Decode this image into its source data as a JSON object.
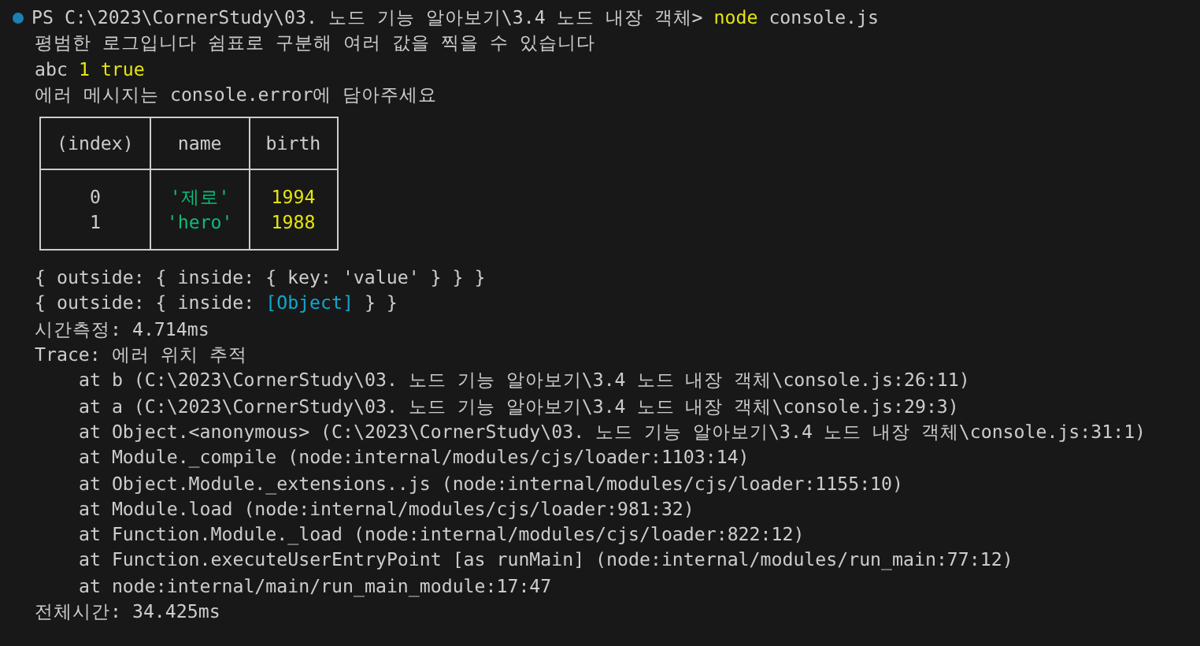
{
  "prompt": {
    "prefix": "PS C:\\2023\\CornerStudy\\03. 노드 기능 알아보기\\3.4 노드 내장 객체>",
    "command": "node",
    "args": "console.js"
  },
  "output_before": [
    {
      "segments": [
        {
          "text": "평범한 로그입니다 쉼표로 구분해 여러 값을 찍을 수 있습니다",
          "kind": "plain"
        }
      ]
    },
    {
      "segments": [
        {
          "text": "abc",
          "kind": "plain"
        },
        {
          "text": "1",
          "kind": "number"
        },
        {
          "text": "true",
          "kind": "number"
        }
      ]
    },
    {
      "segments": [
        {
          "text": "에러 메시지는 console.error에 담아주세요",
          "kind": "plain"
        }
      ]
    }
  ],
  "table": {
    "columns": [
      "(index)",
      "name",
      "birth"
    ],
    "rows": [
      [
        {
          "text": "0",
          "kind": "plain"
        },
        {
          "text": "'제로'",
          "kind": "string"
        },
        {
          "text": "1994",
          "kind": "number"
        }
      ],
      [
        {
          "text": "1",
          "kind": "plain"
        },
        {
          "text": "'hero'",
          "kind": "string"
        },
        {
          "text": "1988",
          "kind": "number"
        }
      ]
    ]
  },
  "output_after": [
    {
      "segments": [
        {
          "text": "{ outside: { inside: { key: 'value' } } }",
          "kind": "plain"
        }
      ]
    },
    {
      "segments": [
        {
          "text": "{ outside: { inside:",
          "kind": "plain"
        },
        {
          "text": "[Object]",
          "kind": "special"
        },
        {
          "text": "} }",
          "kind": "plain"
        }
      ]
    },
    {
      "segments": [
        {
          "text": "시간측정: 4.714ms",
          "kind": "plain"
        }
      ]
    },
    {
      "segments": [
        {
          "text": "Trace: 에러 위치 추적",
          "kind": "plain"
        }
      ],
      "children": [
        {
          "segments": [
            {
              "text": "at b (C:\\2023\\CornerStudy\\03. 노드 기능 알아보기\\3.4 노드 내장 객체\\console.js:26:11)",
              "kind": "plain"
            }
          ]
        },
        {
          "segments": [
            {
              "text": "at a (C:\\2023\\CornerStudy\\03. 노드 기능 알아보기\\3.4 노드 내장 객체\\console.js:29:3)",
              "kind": "plain"
            }
          ]
        },
        {
          "segments": [
            {
              "text": "at Object.<anonymous> (C:\\2023\\CornerStudy\\03. 노드 기능 알아보기\\3.4 노드 내장 객체\\console.js:31:1)",
              "kind": "plain"
            }
          ]
        },
        {
          "segments": [
            {
              "text": "at Module._compile (node:internal/modules/cjs/loader:1103:14)",
              "kind": "plain"
            }
          ]
        },
        {
          "segments": [
            {
              "text": "at Object.Module._extensions..js (node:internal/modules/cjs/loader:1155:10)",
              "kind": "plain"
            }
          ]
        },
        {
          "segments": [
            {
              "text": "at Module.load (node:internal/modules/cjs/loader:981:32)",
              "kind": "plain"
            }
          ]
        },
        {
          "segments": [
            {
              "text": "at Function.Module._load (node:internal/modules/cjs/loader:822:12)",
              "kind": "plain"
            }
          ]
        },
        {
          "segments": [
            {
              "text": "at Function.executeUserEntryPoint [as runMain] (node:internal/modules/run_main:77:12)",
              "kind": "plain"
            }
          ]
        },
        {
          "segments": [
            {
              "text": "at node:internal/main/run_main_module:17:47",
              "kind": "plain"
            }
          ]
        }
      ]
    },
    {
      "segments": [
        {
          "text": "전체시간: 34.425ms",
          "kind": "plain"
        }
      ]
    }
  ]
}
